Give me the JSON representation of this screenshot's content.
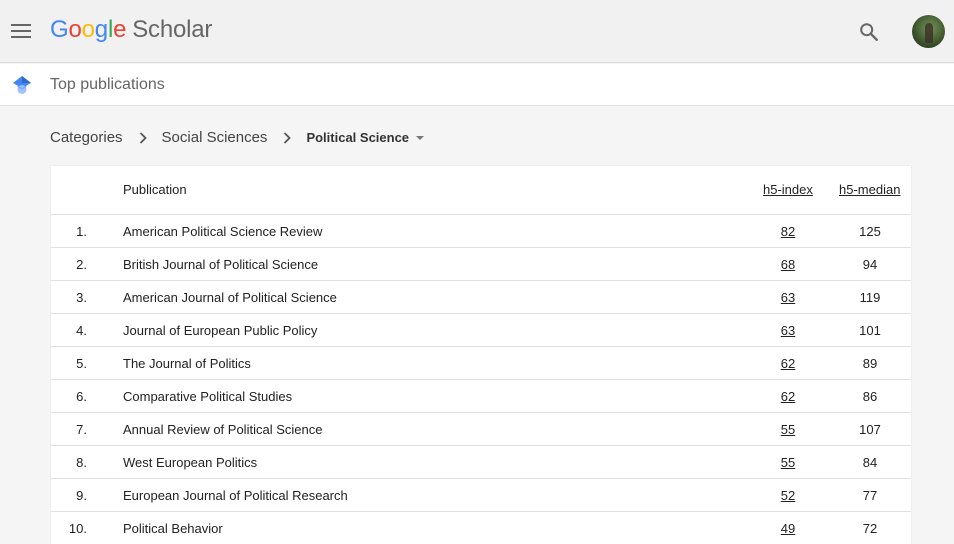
{
  "header": {
    "logo_letters": [
      "G",
      "o",
      "o",
      "g",
      "l",
      "e"
    ],
    "logo_product": "Scholar"
  },
  "subheader": {
    "title": "Top publications"
  },
  "breadcrumb": {
    "items": [
      "Categories",
      "Social Sciences"
    ],
    "current": "Political Science"
  },
  "table": {
    "columns": {
      "publication": "Publication",
      "h5_index": "h5-index",
      "h5_median": "h5-median"
    },
    "rows": [
      {
        "rank": "1.",
        "publication": "American Political Science Review",
        "h5_index": "82",
        "h5_median": "125"
      },
      {
        "rank": "2.",
        "publication": "British Journal of Political Science",
        "h5_index": "68",
        "h5_median": "94"
      },
      {
        "rank": "3.",
        "publication": "American Journal of Political Science",
        "h5_index": "63",
        "h5_median": "119"
      },
      {
        "rank": "4.",
        "publication": "Journal of European Public Policy",
        "h5_index": "63",
        "h5_median": "101"
      },
      {
        "rank": "5.",
        "publication": "The Journal of Politics",
        "h5_index": "62",
        "h5_median": "89"
      },
      {
        "rank": "6.",
        "publication": "Comparative Political Studies",
        "h5_index": "62",
        "h5_median": "86"
      },
      {
        "rank": "7.",
        "publication": "Annual Review of Political Science",
        "h5_index": "55",
        "h5_median": "107"
      },
      {
        "rank": "8.",
        "publication": "West European Politics",
        "h5_index": "55",
        "h5_median": "84"
      },
      {
        "rank": "9.",
        "publication": "European Journal of Political Research",
        "h5_index": "52",
        "h5_median": "77"
      },
      {
        "rank": "10.",
        "publication": "Political Behavior",
        "h5_index": "49",
        "h5_median": "72"
      }
    ]
  },
  "icons": {
    "menu": "hamburger-menu-icon",
    "search": "search-icon",
    "category": "graduation-cap-icon",
    "separator": "chevron-right-icon",
    "dropdown": "caret-down-icon"
  },
  "colors": {
    "google_blue": "#4285f4",
    "google_red": "#ea4335",
    "google_yellow": "#fbbc05",
    "google_green": "#34a853",
    "header_bg": "#f1f1f1",
    "page_bg": "#f5f5f5"
  }
}
